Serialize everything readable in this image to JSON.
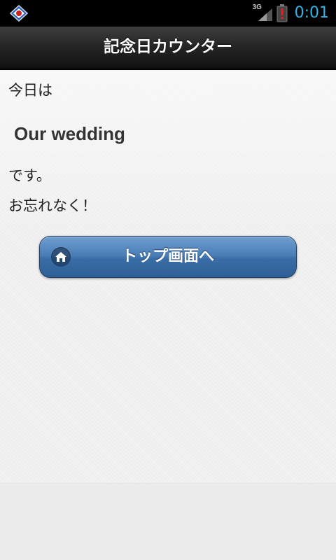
{
  "status_bar": {
    "network_label": "3G",
    "time": "0:01"
  },
  "header": {
    "title": "記念日カウンター"
  },
  "main": {
    "intro": "今日は",
    "anniversary": "Our wedding",
    "suffix": "です。",
    "reminder": "お忘れなく！"
  },
  "button": {
    "label": "トップ画面へ",
    "icon": "home-icon"
  },
  "colors": {
    "status_time": "#33b5e5",
    "button_blue": "#3a6da6"
  }
}
